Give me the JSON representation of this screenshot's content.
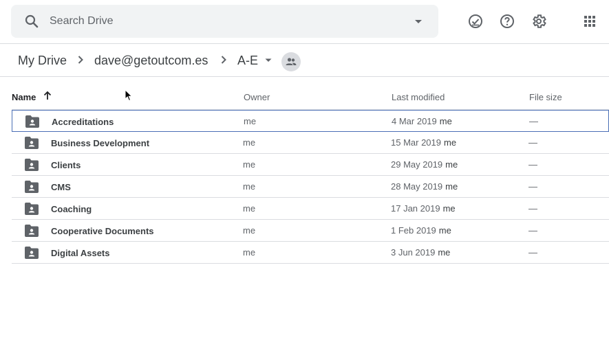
{
  "search": {
    "placeholder": "Search Drive",
    "icon": "search-icon"
  },
  "header_icons": [
    "offline-ready-icon",
    "help-icon",
    "settings-icon",
    "apps-grid-icon"
  ],
  "breadcrumb": {
    "items": [
      "My Drive",
      "dave@getoutcom.es",
      "A-E"
    ]
  },
  "table": {
    "columns": {
      "name": "Name",
      "owner": "Owner",
      "modified": "Last modified",
      "size": "File size"
    },
    "rows": [
      {
        "name": "Accreditations",
        "owner": "me",
        "date": "4 Mar 2019",
        "by": "me",
        "size": "—"
      },
      {
        "name": "Business Development",
        "owner": "me",
        "date": "15 Mar 2019",
        "by": "me",
        "size": "—"
      },
      {
        "name": "Clients",
        "owner": "me",
        "date": "29 May 2019",
        "by": "me",
        "size": "—"
      },
      {
        "name": "CMS",
        "owner": "me",
        "date": "28 May 2019",
        "by": "me",
        "size": "—"
      },
      {
        "name": "Coaching",
        "owner": "me",
        "date": "17 Jan 2019",
        "by": "me",
        "size": "—"
      },
      {
        "name": "Cooperative Documents",
        "owner": "me",
        "date": "1 Feb 2019",
        "by": "me",
        "size": "—"
      },
      {
        "name": "Digital Assets",
        "owner": "me",
        "date": "3 Jun 2019",
        "by": "me",
        "size": "—"
      }
    ]
  },
  "colors": {
    "selected_border": "#4a6eb5",
    "icon_gray": "#5f6368",
    "search_bg": "#f1f3f4"
  }
}
